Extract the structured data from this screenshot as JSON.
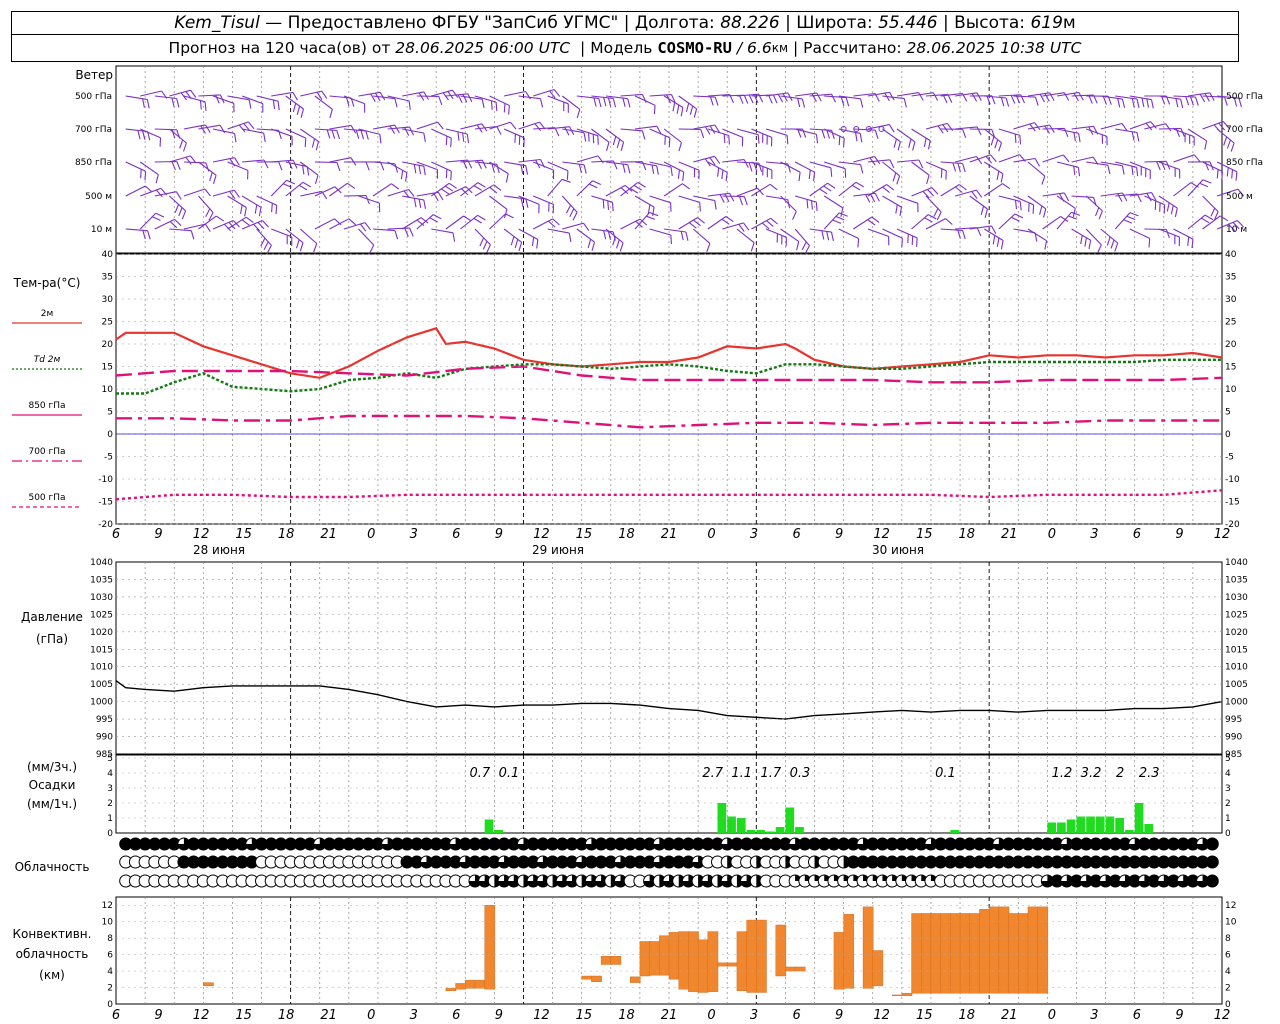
{
  "header": {
    "station": "Kem_Tisul",
    "dash": "—",
    "provider": "Предоставлено ФГБУ \"ЗапСиб УГМС\"",
    "lon_label": "Долгота:",
    "lon_value": "88.226",
    "lat_label": "Широта:",
    "lat_value": "55.446",
    "alt_label": "Высота:",
    "alt_value": "619",
    "alt_unit": "м",
    "forecast_prefix": "Прогноз на 120 часа(ов) от",
    "forecast_time": "28.06.2025 06:00 UTC",
    "model_label": "Модель",
    "model_name": "COSMO-RU",
    "model_res": "/ 6.6",
    "model_res_unit": "км",
    "calc_label": "Рассчитано:",
    "calc_time": "28.06.2025 10:38 UTC"
  },
  "panels": {
    "wind": {
      "title": "Ветер",
      "levels": [
        "500 гПа",
        "700 гПа",
        "850 гПа",
        "500 м",
        "10  м"
      ]
    },
    "temperature": {
      "title": "Тем-ра(°C)",
      "legend": [
        {
          "label": "2м",
          "color": "#e8342e",
          "style": "solid"
        },
        {
          "label": "Td  2м",
          "color": "#137a13",
          "style": "dotted"
        },
        {
          "label": "850 гПа",
          "color": "#e0107a",
          "style": "longdash"
        },
        {
          "label": "700 гПа",
          "color": "#e0107a",
          "style": "dashdot"
        },
        {
          "label": "500 гПа",
          "color": "#e0107a",
          "style": "dot"
        }
      ]
    },
    "pressure": {
      "title": "Давление",
      "unit": "(гПа)"
    },
    "precip": {
      "unit3": "(мм/3ч.)",
      "title": "Осадки",
      "unit1": "(мм/1ч.)"
    },
    "cloud": {
      "title": "Облачность"
    },
    "convective": {
      "title_1": "Конвективн.",
      "title_2": "облачность",
      "unit": "(км)"
    }
  },
  "time_axis": {
    "hour_labels": [
      "6",
      "9",
      "12",
      "15",
      "18",
      "21",
      "0",
      "3",
      "6",
      "9",
      "12",
      "15",
      "18",
      "21",
      "0",
      "3",
      "6",
      "9",
      "12",
      "15",
      "18",
      "21",
      "0",
      "3",
      "6",
      "9",
      "12"
    ],
    "date_labels": [
      "28 июня",
      "29 июня",
      "30 июня"
    ]
  },
  "colors": {
    "wind": "#7b2fc6",
    "t2m": "#e8342e",
    "td2m": "#137a13",
    "upper": "#e0107a",
    "pressure": "#000000",
    "precip": "#1fdc1f",
    "convective": "#f0872e",
    "zero_line": "#1a1adc"
  },
  "chart_data": [
    {
      "type": "line",
      "title": "Тем-ра(°C)",
      "ylim": [
        -20,
        40
      ],
      "x_unit": "hours since 28.06.2025 06:00 UTC",
      "series": [
        {
          "name": "2м",
          "x": [
            0,
            1,
            3,
            6,
            9,
            12,
            15,
            18,
            21,
            24,
            27,
            30,
            33,
            34,
            36,
            39,
            42,
            45,
            48,
            51,
            54,
            57,
            60,
            63,
            66,
            69,
            70,
            72,
            73,
            75,
            78,
            81,
            84,
            87,
            90,
            93,
            96,
            99,
            102,
            105,
            108,
            111,
            114
          ],
          "y": [
            21,
            22.5,
            22.5,
            22.5,
            19.5,
            17.5,
            15.5,
            13.5,
            12.5,
            15,
            18.5,
            21.5,
            23.5,
            20,
            20.5,
            19,
            16.5,
            15.5,
            15,
            15.5,
            16,
            16,
            17,
            19.5,
            19,
            20,
            19,
            16.5,
            16,
            15,
            14.5,
            15,
            15.5,
            16,
            17.5,
            17,
            17.5,
            17.5,
            17,
            17.5,
            17.5,
            18,
            17
          ]
        },
        {
          "name": "Td  2м",
          "x": [
            0,
            3,
            6,
            9,
            12,
            15,
            18,
            21,
            24,
            27,
            30,
            33,
            36,
            39,
            42,
            45,
            48,
            51,
            54,
            57,
            60,
            63,
            66,
            69,
            72,
            75,
            78,
            81,
            84,
            87,
            90,
            93,
            96,
            99,
            102,
            105,
            108,
            111,
            114
          ],
          "y": [
            9,
            9,
            11.5,
            13.5,
            10.5,
            10,
            9.5,
            10,
            12,
            12.5,
            13.5,
            12.5,
            14.5,
            15,
            15.5,
            15.5,
            15,
            14.5,
            15,
            15.5,
            15,
            14,
            13.5,
            15.5,
            15.5,
            15,
            14.5,
            14.5,
            15,
            15.5,
            16,
            16,
            16,
            16,
            16,
            16,
            16.5,
            16.5,
            16.5
          ]
        },
        {
          "name": "850 гПа",
          "x": [
            0,
            6,
            12,
            18,
            24,
            30,
            36,
            42,
            48,
            54,
            60,
            66,
            72,
            78,
            84,
            90,
            96,
            102,
            108,
            114
          ],
          "y": [
            13,
            14,
            14,
            14,
            13.5,
            13,
            14.5,
            15,
            13,
            12,
            12,
            12,
            12,
            12,
            11.5,
            11.5,
            12,
            12,
            12,
            12.5
          ]
        },
        {
          "name": "700 гПа",
          "x": [
            0,
            6,
            12,
            18,
            24,
            30,
            36,
            42,
            48,
            54,
            60,
            66,
            72,
            78,
            84,
            90,
            96,
            102,
            108,
            114
          ],
          "y": [
            3.5,
            3.5,
            3,
            3,
            4,
            4,
            4,
            3.5,
            2.5,
            1.5,
            2,
            2.5,
            2.5,
            2,
            2.5,
            2.5,
            2.5,
            3,
            3,
            3
          ]
        },
        {
          "name": "500 гПа",
          "x": [
            0,
            6,
            12,
            18,
            24,
            30,
            36,
            42,
            48,
            54,
            60,
            66,
            72,
            78,
            84,
            90,
            96,
            102,
            108,
            114
          ],
          "y": [
            -14.5,
            -13.5,
            -13.5,
            -14,
            -14,
            -13.5,
            -13.5,
            -13.5,
            -13.5,
            -13.5,
            -13.5,
            -13.5,
            -13.5,
            -13.5,
            -13.5,
            -14,
            -13.5,
            -13.5,
            -13.5,
            -12.5
          ]
        }
      ]
    },
    {
      "type": "line",
      "title": "Давление",
      "ylim": [
        985,
        1040
      ],
      "x_unit": "hours since 28.06.2025 06:00 UTC",
      "series": [
        {
          "name": "Давление",
          "x": [
            0,
            1,
            3,
            6,
            9,
            12,
            15,
            18,
            21,
            24,
            27,
            30,
            33,
            36,
            39,
            42,
            45,
            48,
            51,
            54,
            57,
            60,
            63,
            66,
            69,
            72,
            75,
            78,
            81,
            84,
            87,
            90,
            93,
            96,
            99,
            102,
            105,
            108,
            111,
            114
          ],
          "y": [
            1006,
            1004,
            1003.5,
            1003,
            1004,
            1004.5,
            1004.5,
            1004.5,
            1004.5,
            1003.5,
            1002,
            1000,
            998.5,
            999,
            998.5,
            999,
            999,
            999.5,
            999.5,
            999,
            998,
            997.5,
            996,
            995.5,
            995,
            996,
            996.5,
            997,
            997.5,
            997,
            997.5,
            997.5,
            997,
            997.5,
            997.5,
            997.5,
            998,
            998,
            998.5,
            1000
          ]
        }
      ]
    },
    {
      "type": "bar",
      "title": "Осадки",
      "ylim": [
        0,
        5
      ],
      "x_unit": "hours since 28.06.2025 06:00 UTC",
      "bars": [
        {
          "x": 38,
          "v": 0.9
        },
        {
          "x": 39,
          "v": 0.2
        },
        {
          "x": 62,
          "v": 2.0
        },
        {
          "x": 63,
          "v": 1.1
        },
        {
          "x": 64,
          "v": 1.0
        },
        {
          "x": 65,
          "v": 0.2
        },
        {
          "x": 66,
          "v": 0.2
        },
        {
          "x": 67,
          "v": 0.1
        },
        {
          "x": 68,
          "v": 0.4
        },
        {
          "x": 69,
          "v": 1.7
        },
        {
          "x": 70,
          "v": 0.4
        },
        {
          "x": 86,
          "v": 0.2
        },
        {
          "x": 96,
          "v": 0.7
        },
        {
          "x": 97,
          "v": 0.7
        },
        {
          "x": 98,
          "v": 0.9
        },
        {
          "x": 99,
          "v": 1.1
        },
        {
          "x": 100,
          "v": 1.1
        },
        {
          "x": 101,
          "v": 1.1
        },
        {
          "x": 102,
          "v": 1.1
        },
        {
          "x": 103,
          "v": 1.0
        },
        {
          "x": 104,
          "v": 0.2
        },
        {
          "x": 105,
          "v": 2.0
        },
        {
          "x": 106,
          "v": 0.6
        }
      ],
      "labels": [
        {
          "x": 37.5,
          "text": "0.7"
        },
        {
          "x": 40.5,
          "text": "0.1"
        },
        {
          "x": 61.5,
          "text": "2.7"
        },
        {
          "x": 64.5,
          "text": "1.1"
        },
        {
          "x": 67.5,
          "text": "1.7"
        },
        {
          "x": 70.5,
          "text": "0.3"
        },
        {
          "x": 85.5,
          "text": "0.1"
        },
        {
          "x": 97.5,
          "text": "1.2"
        },
        {
          "x": 100.5,
          "text": "3.2"
        },
        {
          "x": 103.5,
          "text": "2"
        },
        {
          "x": 106.5,
          "text": "2.3"
        }
      ]
    },
    {
      "type": "bar",
      "title": "Конвективн. облачность",
      "ylim": [
        0,
        13
      ],
      "x_unit": "hours since 28.06.2025 06:00 UTC",
      "bars": [
        {
          "x": 9,
          "lo": 2.2,
          "hi": 2.6
        },
        {
          "x": 34,
          "lo": 1.6,
          "hi": 1.9
        },
        {
          "x": 35,
          "lo": 1.8,
          "hi": 2.5
        },
        {
          "x": 36,
          "lo": 1.9,
          "hi": 2.9
        },
        {
          "x": 37,
          "lo": 1.9,
          "hi": 2.9
        },
        {
          "x": 38,
          "lo": 1.8,
          "hi": 12
        },
        {
          "x": 48,
          "lo": 3,
          "hi": 3.4
        },
        {
          "x": 49,
          "lo": 2.7,
          "hi": 3.4
        },
        {
          "x": 50,
          "lo": 4.8,
          "hi": 5.8
        },
        {
          "x": 51,
          "lo": 4.8,
          "hi": 5.8
        },
        {
          "x": 53,
          "lo": 2.6,
          "hi": 3.3
        },
        {
          "x": 54,
          "lo": 3.4,
          "hi": 7.6
        },
        {
          "x": 55,
          "lo": 3.5,
          "hi": 7.6
        },
        {
          "x": 56,
          "lo": 3.5,
          "hi": 8.3
        },
        {
          "x": 57,
          "lo": 3.0,
          "hi": 8.7
        },
        {
          "x": 58,
          "lo": 1.8,
          "hi": 8.8
        },
        {
          "x": 59,
          "lo": 1.5,
          "hi": 8.8
        },
        {
          "x": 60,
          "lo": 1.4,
          "hi": 7.8
        },
        {
          "x": 61,
          "lo": 1.5,
          "hi": 8.8
        },
        {
          "x": 62,
          "lo": 4.6,
          "hi": 5.0
        },
        {
          "x": 63,
          "lo": 4.6,
          "hi": 5.0
        },
        {
          "x": 64,
          "lo": 1.6,
          "hi": 8.8
        },
        {
          "x": 65,
          "lo": 1.4,
          "hi": 10.2
        },
        {
          "x": 66,
          "lo": 1.4,
          "hi": 10.2
        },
        {
          "x": 68,
          "lo": 3.4,
          "hi": 9.6
        },
        {
          "x": 69,
          "lo": 4.0,
          "hi": 4.5
        },
        {
          "x": 70,
          "lo": 4.0,
          "hi": 4.5
        },
        {
          "x": 74,
          "lo": 1.8,
          "hi": 8.7
        },
        {
          "x": 75,
          "lo": 1.9,
          "hi": 10.9
        },
        {
          "x": 77,
          "lo": 1.9,
          "hi": 11.8
        },
        {
          "x": 78,
          "lo": 2.2,
          "hi": 6.5
        },
        {
          "x": 80,
          "lo": 1.0,
          "hi": 1.1
        },
        {
          "x": 81,
          "lo": 1.0,
          "hi": 1.3
        },
        {
          "x": 82,
          "lo": 1.3,
          "hi": 11
        },
        {
          "x": 83,
          "lo": 1.3,
          "hi": 11
        },
        {
          "x": 84,
          "lo": 1.3,
          "hi": 11
        },
        {
          "x": 85,
          "lo": 1.3,
          "hi": 11
        },
        {
          "x": 86,
          "lo": 1.3,
          "hi": 11
        },
        {
          "x": 87,
          "lo": 1.3,
          "hi": 11
        },
        {
          "x": 88,
          "lo": 1.3,
          "hi": 11
        },
        {
          "x": 89,
          "lo": 1.3,
          "hi": 11.5
        },
        {
          "x": 90,
          "lo": 1.3,
          "hi": 11.8
        },
        {
          "x": 91,
          "lo": 1.3,
          "hi": 11.8
        },
        {
          "x": 92,
          "lo": 1.3,
          "hi": 11
        },
        {
          "x": 93,
          "lo": 1.3,
          "hi": 11
        },
        {
          "x": 94,
          "lo": 1.3,
          "hi": 11.8
        },
        {
          "x": 95,
          "lo": 1.3,
          "hi": 11.8
        }
      ]
    }
  ]
}
